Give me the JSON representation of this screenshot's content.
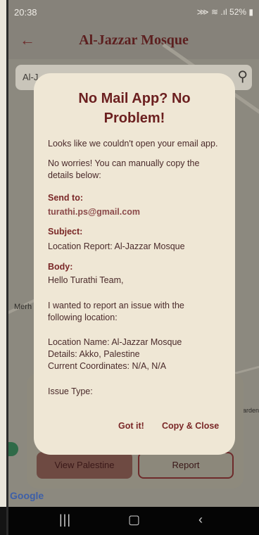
{
  "status_bar": {
    "time": "20:38",
    "icons_text": "» ☰ .∣ 52%",
    "battery": "52%"
  },
  "app_bar": {
    "back_icon": "arrow-left-icon",
    "title": "Al-Jazzar Mosque"
  },
  "search": {
    "value": "Al-J",
    "icon": "search-icon"
  },
  "map": {
    "label_merh": "Merh",
    "label_arden": "arden",
    "attribution": "Google"
  },
  "bottom_card": {
    "view_button": "View Palestine",
    "report_button": "Report"
  },
  "dialog": {
    "title_line1": "No Mail App? No",
    "title_line2": "Problem!",
    "intro": "Looks like we couldn't open your email app.",
    "worries_line1": "No worries! You can manually copy the",
    "worries_line2": "details below:",
    "send_to_label": "Send to:",
    "email": "turathi.ps@gmail.com",
    "subject_label": "Subject:",
    "subject": "Location Report: Al-Jazzar Mosque",
    "body_label": "Body:",
    "body_greeting": "Hello Turathi Team,",
    "body_line1": "I wanted to report an issue with the",
    "body_line2": "following location:",
    "location_name": "Location Name: Al-Jazzar Mosque",
    "details": "Details: Akko, Palestine",
    "coordinates": "Current Coordinates: N/A, N/A",
    "issue_type": "Issue Type:",
    "gotit_button": "Got it!",
    "copy_button": "Copy & Close"
  },
  "nav_bar": {
    "recent_icon": "recent-apps-icon",
    "home_icon": "home-icon",
    "back_icon": "back-chevron-icon"
  }
}
